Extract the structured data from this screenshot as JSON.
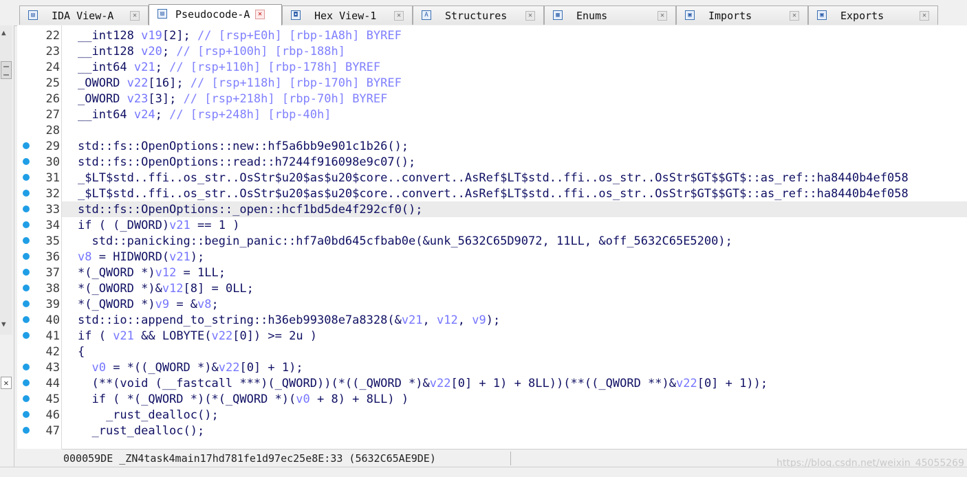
{
  "tabs": [
    {
      "label": "IDA View-A",
      "icon": "ida-view-icon",
      "active": false
    },
    {
      "label": "Pseudocode-A",
      "icon": "pseudocode-icon",
      "active": true
    },
    {
      "label": "Hex View-1",
      "icon": "hex-view-icon",
      "active": false
    },
    {
      "label": "Structures",
      "icon": "structures-icon",
      "active": false
    },
    {
      "label": "Enums",
      "icon": "enums-icon",
      "active": false
    },
    {
      "label": "Imports",
      "icon": "imports-icon",
      "active": false
    },
    {
      "label": "Exports",
      "icon": "exports-icon",
      "active": false
    }
  ],
  "code": {
    "lines": [
      {
        "num": "22",
        "bp": false,
        "text": "__int128 v19[2]; // [rsp+E0h] [rbp-1A8h] BYREF"
      },
      {
        "num": "23",
        "bp": false,
        "text": "__int128 v20; // [rsp+100h] [rbp-188h]"
      },
      {
        "num": "24",
        "bp": false,
        "text": "__int64 v21; // [rsp+110h] [rbp-178h] BYREF"
      },
      {
        "num": "25",
        "bp": false,
        "text": "_OWORD v22[16]; // [rsp+118h] [rbp-170h] BYREF"
      },
      {
        "num": "26",
        "bp": false,
        "text": "_OWORD v23[3]; // [rsp+218h] [rbp-70h] BYREF"
      },
      {
        "num": "27",
        "bp": false,
        "text": "__int64 v24; // [rsp+248h] [rbp-40h]"
      },
      {
        "num": "28",
        "bp": false,
        "text": ""
      },
      {
        "num": "29",
        "bp": true,
        "text": "std::fs::OpenOptions::new::hf5a6bb9e901c1b26();"
      },
      {
        "num": "30",
        "bp": true,
        "text": "std::fs::OpenOptions::read::h7244f916098e9c07();"
      },
      {
        "num": "31",
        "bp": true,
        "text": "_$LT$std..ffi..os_str..OsStr$u20$as$u20$core..convert..AsRef$LT$std..ffi..os_str..OsStr$GT$$GT$::as_ref::ha8440b4ef058"
      },
      {
        "num": "32",
        "bp": true,
        "text": "_$LT$std..ffi..os_str..OsStr$u20$as$u20$core..convert..AsRef$LT$std..ffi..os_str..OsStr$GT$$GT$::as_ref::ha8440b4ef058"
      },
      {
        "num": "33",
        "bp": true,
        "text": "std::fs::OpenOptions::_open::hcf1bd5de4f292cf0();",
        "highlight": true
      },
      {
        "num": "34",
        "bp": true,
        "text": "if ( (_DWORD)v21 == 1 )"
      },
      {
        "num": "35",
        "bp": true,
        "text": "  std::panicking::begin_panic::hf7a0bd645cfbab0e(&unk_5632C65D9072, 11LL, &off_5632C65E5200);"
      },
      {
        "num": "36",
        "bp": true,
        "text": "v8 = HIDWORD(v21);"
      },
      {
        "num": "37",
        "bp": true,
        "text": "*(_QWORD *)v12 = 1LL;"
      },
      {
        "num": "38",
        "bp": true,
        "text": "*(_OWORD *)&v12[8] = 0LL;"
      },
      {
        "num": "39",
        "bp": true,
        "text": "*(_QWORD *)v9 = &v8;"
      },
      {
        "num": "40",
        "bp": true,
        "text": "std::io::append_to_string::h36eb99308e7a8328(&v21, v12, v9);"
      },
      {
        "num": "41",
        "bp": true,
        "text": "if ( v21 && LOBYTE(v22[0]) >= 2u )"
      },
      {
        "num": "42",
        "bp": false,
        "text": "{"
      },
      {
        "num": "43",
        "bp": true,
        "text": "  v0 = *((_QWORD *)&v22[0] + 1);"
      },
      {
        "num": "44",
        "bp": true,
        "text": "  (**(void (__fastcall ***)(_QWORD))(*((_QWORD *)&v22[0] + 1) + 8LL))(**((_QWORD **)&v22[0] + 1));"
      },
      {
        "num": "45",
        "bp": true,
        "text": "  if ( *(_QWORD *)(*(_QWORD *)(v0 + 8) + 8LL) )"
      },
      {
        "num": "46",
        "bp": true,
        "text": "    _rust_dealloc();"
      },
      {
        "num": "47",
        "bp": true,
        "text": "  _rust_dealloc();"
      }
    ]
  },
  "status": {
    "text": "000059DE _ZN4task4main17hd781fe1d97ec25e8E:33 (5632C65AE9DE)",
    "watermark": "https://blog.csdn.net/weixin_45055269"
  },
  "colors": {
    "code_text": "#101064",
    "comment": "#8080ff",
    "variable": "#7575ff",
    "breakpoint": "#1f9ee6",
    "current_line": "#ebebeb"
  }
}
